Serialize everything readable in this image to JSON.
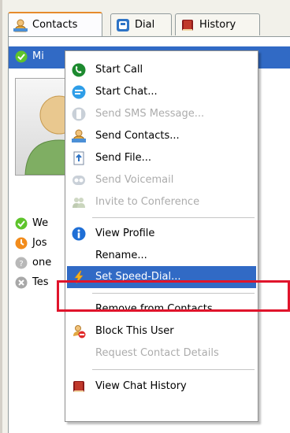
{
  "tabs": [
    {
      "label": "Contacts",
      "icon": "contacts-icon",
      "active": true
    },
    {
      "label": "Dial",
      "icon": "dial-icon",
      "active": false
    },
    {
      "label": "History",
      "icon": "history-book-icon",
      "active": false
    }
  ],
  "selected_contact": {
    "name": "Mi",
    "status": "online"
  },
  "contacts": [
    {
      "name": "We",
      "status": "online"
    },
    {
      "name": "Jos",
      "status": "away"
    },
    {
      "name": "one",
      "status": "offline"
    },
    {
      "name": "Tes",
      "status": "not-available"
    }
  ],
  "menu": {
    "items": [
      {
        "label": "Start Call",
        "icon": "phone-icon",
        "disabled": false
      },
      {
        "label": "Start Chat...",
        "icon": "chat-icon",
        "disabled": false
      },
      {
        "label": "Send SMS Message...",
        "icon": "sms-icon",
        "disabled": true
      },
      {
        "label": "Send Contacts...",
        "icon": "send-contacts-icon",
        "disabled": false
      },
      {
        "label": "Send File...",
        "icon": "send-file-icon",
        "disabled": false
      },
      {
        "label": "Send Voicemail",
        "icon": "voicemail-icon",
        "disabled": true
      },
      {
        "label": "Invite to Conference",
        "icon": "conference-icon",
        "disabled": true
      },
      {
        "label": "View Profile",
        "icon": "info-icon",
        "disabled": false
      },
      {
        "label": "Rename...",
        "icon": "",
        "disabled": false
      },
      {
        "label": "Set Speed-Dial...",
        "icon": "speed-dial-icon",
        "disabled": false,
        "highlighted": true
      },
      {
        "label": "Remove from Contacts",
        "icon": "",
        "disabled": false
      },
      {
        "label": "Block This User",
        "icon": "block-user-icon",
        "disabled": false
      },
      {
        "label": "Request Contact Details",
        "icon": "",
        "disabled": true
      },
      {
        "label": "View Chat History",
        "icon": "chat-history-icon",
        "disabled": false
      }
    ]
  },
  "colors": {
    "selection": "#316ac5",
    "highlight_box": "#e0142b",
    "online": "#5ec42b",
    "away": "#f28c1c",
    "offline": "#b8b8b8"
  }
}
